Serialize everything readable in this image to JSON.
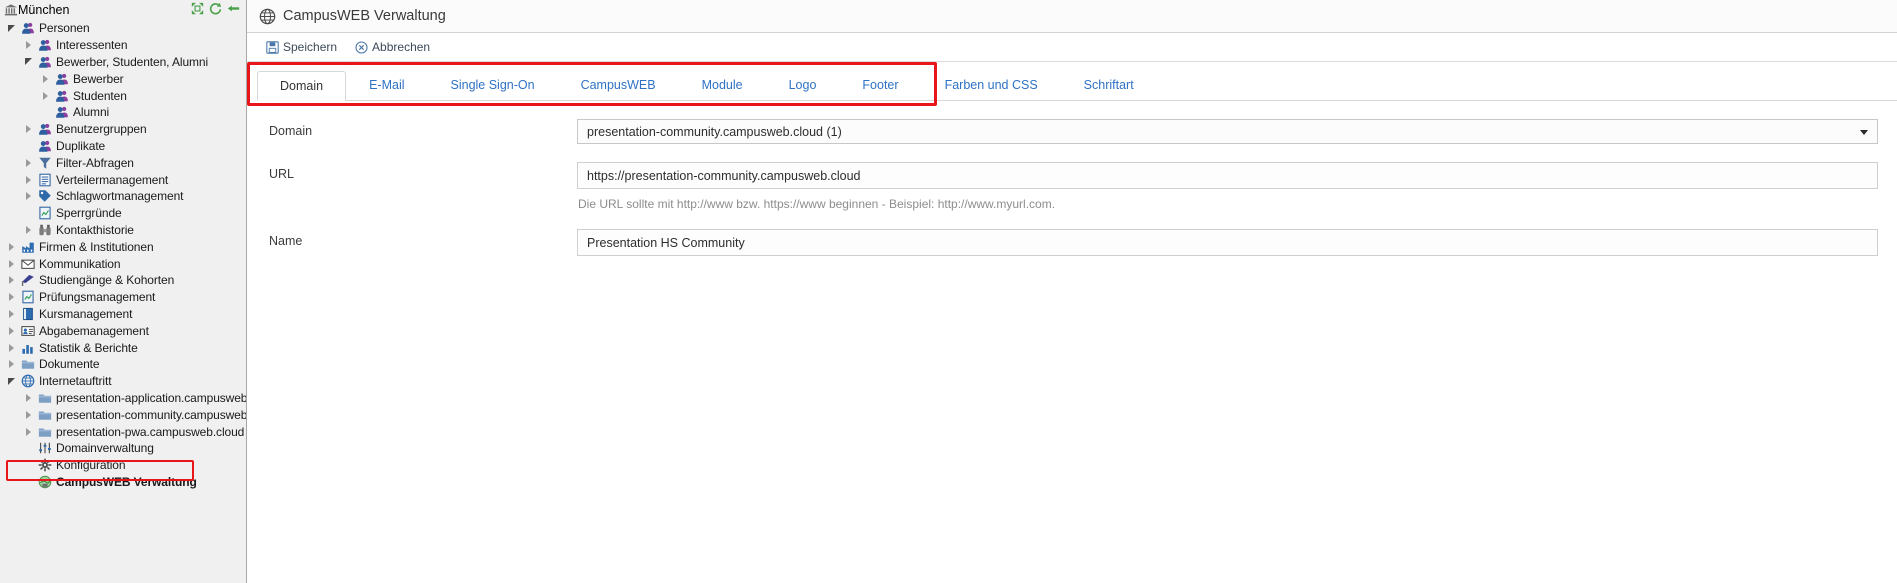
{
  "sidebar": {
    "root": {
      "label": "München",
      "icon": "bank-icon"
    },
    "top_actions": [
      {
        "name": "collapse-all-icon",
        "label": "Collapse all"
      },
      {
        "name": "refresh-icon",
        "label": "Refresh"
      },
      {
        "name": "back-arrow-icon",
        "label": "Back"
      }
    ],
    "items": [
      {
        "label": "Personen",
        "depth": 0,
        "twisty": "expanded",
        "icon": "people-icon"
      },
      {
        "label": "Interessenten",
        "depth": 1,
        "twisty": "collapsed",
        "icon": "people-icon"
      },
      {
        "label": "Bewerber, Studenten, Alumni",
        "depth": 1,
        "twisty": "expanded",
        "icon": "people-icon"
      },
      {
        "label": "Bewerber",
        "depth": 2,
        "twisty": "collapsed",
        "icon": "people-icon"
      },
      {
        "label": "Studenten",
        "depth": 2,
        "twisty": "collapsed",
        "icon": "people-icon"
      },
      {
        "label": "Alumni",
        "depth": 2,
        "twisty": "none",
        "icon": "people-icon"
      },
      {
        "label": "Benutzergruppen",
        "depth": 1,
        "twisty": "collapsed",
        "icon": "people-icon"
      },
      {
        "label": "Duplikate",
        "depth": 1,
        "twisty": "none",
        "icon": "people-icon"
      },
      {
        "label": "Filter-Abfragen",
        "depth": 1,
        "twisty": "collapsed",
        "icon": "funnel-icon"
      },
      {
        "label": "Verteilermanagement",
        "depth": 1,
        "twisty": "collapsed",
        "icon": "list-icon"
      },
      {
        "label": "Schlagwortmanagement",
        "depth": 1,
        "twisty": "collapsed",
        "icon": "tag-icon"
      },
      {
        "label": "Sperrgründe",
        "depth": 1,
        "twisty": "none",
        "icon": "report-icon"
      },
      {
        "label": "Kontakthistorie",
        "depth": 1,
        "twisty": "collapsed",
        "icon": "binocular-icon"
      },
      {
        "label": "Firmen & Institutionen",
        "depth": 0,
        "twisty": "collapsed",
        "icon": "factory-icon"
      },
      {
        "label": "Kommunikation",
        "depth": 0,
        "twisty": "collapsed",
        "icon": "envelope-icon"
      },
      {
        "label": "Studiengänge & Kohorten",
        "depth": 0,
        "twisty": "collapsed",
        "icon": "graduation-icon"
      },
      {
        "label": "Prüfungsmanagement",
        "depth": 0,
        "twisty": "collapsed",
        "icon": "report-icon"
      },
      {
        "label": "Kursmanagement",
        "depth": 0,
        "twisty": "collapsed",
        "icon": "book-icon"
      },
      {
        "label": "Abgabemanagement",
        "depth": 0,
        "twisty": "collapsed",
        "icon": "idcard-icon"
      },
      {
        "label": "Statistik & Berichte",
        "depth": 0,
        "twisty": "collapsed",
        "icon": "barchart-icon"
      },
      {
        "label": "Dokumente",
        "depth": 0,
        "twisty": "collapsed",
        "icon": "folder-icon"
      },
      {
        "label": "Internetauftritt",
        "depth": 0,
        "twisty": "expanded",
        "icon": "globe-icon"
      },
      {
        "label": "presentation-application.campusweb.clou",
        "depth": 1,
        "twisty": "collapsed",
        "icon": "folder-icon"
      },
      {
        "label": "presentation-community.campusweb.clou",
        "depth": 1,
        "twisty": "collapsed",
        "icon": "folder-icon"
      },
      {
        "label": "presentation-pwa.campusweb.cloud",
        "depth": 1,
        "twisty": "collapsed",
        "icon": "folder-icon"
      },
      {
        "label": "Domainverwaltung",
        "depth": 1,
        "twisty": "none",
        "icon": "sliders-icon"
      },
      {
        "label": "Konfiguration",
        "depth": 1,
        "twisty": "none",
        "icon": "gear-icon"
      },
      {
        "label": "CampusWEB Verwaltung",
        "depth": 1,
        "twisty": "none",
        "icon": "globe-green-icon",
        "selected": true
      }
    ]
  },
  "header": {
    "title": "CampusWEB Verwaltung",
    "icon": "globe-icon"
  },
  "toolbar": {
    "save_label": "Speichern",
    "save_icon": "save-disk-icon",
    "cancel_label": "Abbrechen",
    "cancel_icon": "cancel-circle-icon"
  },
  "tabs": [
    {
      "label": "Domain",
      "active": true
    },
    {
      "label": "E-Mail",
      "active": false
    },
    {
      "label": "Single Sign-On",
      "active": false
    },
    {
      "label": "CampusWEB",
      "active": false
    },
    {
      "label": "Module",
      "active": false
    },
    {
      "label": "Logo",
      "active": false
    },
    {
      "label": "Footer",
      "active": false
    },
    {
      "label": "Farben und CSS",
      "active": false
    },
    {
      "label": "Schriftart",
      "active": false
    }
  ],
  "form": {
    "domain": {
      "label": "Domain",
      "value": "presentation-community.campusweb.cloud (1)"
    },
    "url": {
      "label": "URL",
      "value": "https://presentation-community.campusweb.cloud",
      "hint": "Die URL sollte mit http://www bzw. https://www beginnen - Beispiel: http://www.myurl.com."
    },
    "name": {
      "label": "Name",
      "value": "Presentation HS Community"
    }
  },
  "annotations": {
    "highlight_color": "#e8151b",
    "tab_strip_highlight": "Domain tab strip",
    "sidebar_highlight": "CampusWEB Verwaltung"
  }
}
